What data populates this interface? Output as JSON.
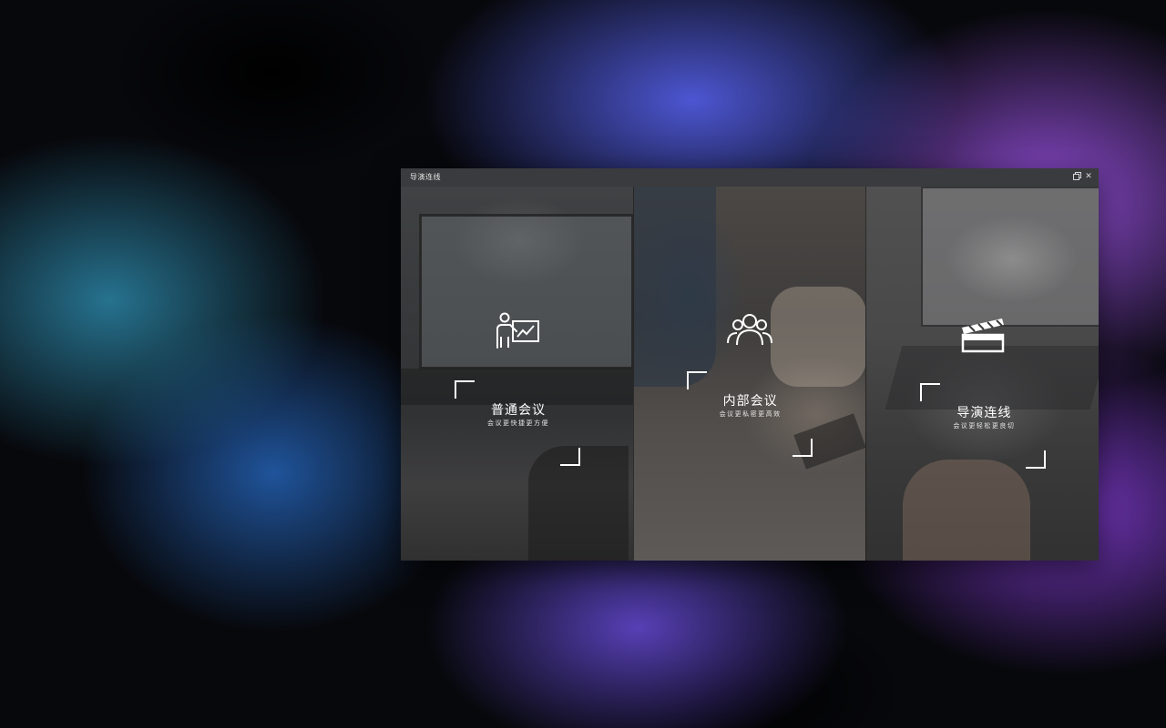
{
  "window": {
    "title": "导演连线",
    "restore_icon": "restore-icon",
    "close_icon": "close-icon",
    "close_glyph": "✕"
  },
  "panels": [
    {
      "title": "普通会议",
      "subtitle": "会议更快捷更方便",
      "icon": "presentation-icon"
    },
    {
      "title": "内部会议",
      "subtitle": "会议更私密更高效",
      "icon": "group-icon"
    },
    {
      "title": "导演连线",
      "subtitle": "会议更轻松更良切",
      "icon": "clapperboard-icon"
    }
  ],
  "colors": {
    "titlebar": "#3a3b3e",
    "text": "#ffffff"
  }
}
